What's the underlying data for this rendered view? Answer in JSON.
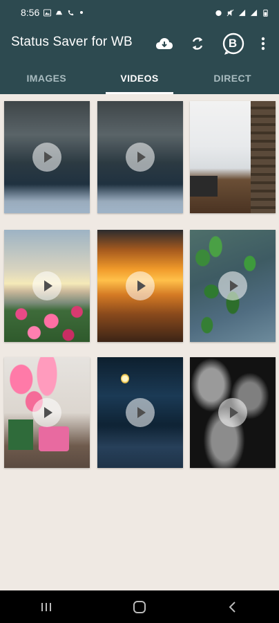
{
  "status_bar": {
    "time": "8:56"
  },
  "app": {
    "title": "Status Saver for WB",
    "business_badge": "B"
  },
  "tabs": [
    {
      "label": "IMAGES",
      "active": false
    },
    {
      "label": "VIDEOS",
      "active": true
    },
    {
      "label": "DIRECT",
      "active": false
    }
  ],
  "videos": [
    {
      "id": "stormy-sea-1",
      "icon": "play-icon"
    },
    {
      "id": "stormy-sea-2",
      "icon": "play-icon"
    },
    {
      "id": "snowy-window-room",
      "icon": "none"
    },
    {
      "id": "flowers-sunset-beach",
      "icon": "play-icon"
    },
    {
      "id": "golden-sunset-pier",
      "icon": "play-icon"
    },
    {
      "id": "rain-leaves",
      "icon": "play-icon"
    },
    {
      "id": "pink-lilies-mug",
      "icon": "play-icon"
    },
    {
      "id": "night-lamp-bench",
      "icon": "play-icon"
    },
    {
      "id": "night-clouds",
      "icon": "play-icon"
    }
  ],
  "colors": {
    "bar": "#2d4a50",
    "background": "#efe9e3",
    "tab_active": "#ffffff",
    "tab_inactive": "#a9bcc0"
  }
}
